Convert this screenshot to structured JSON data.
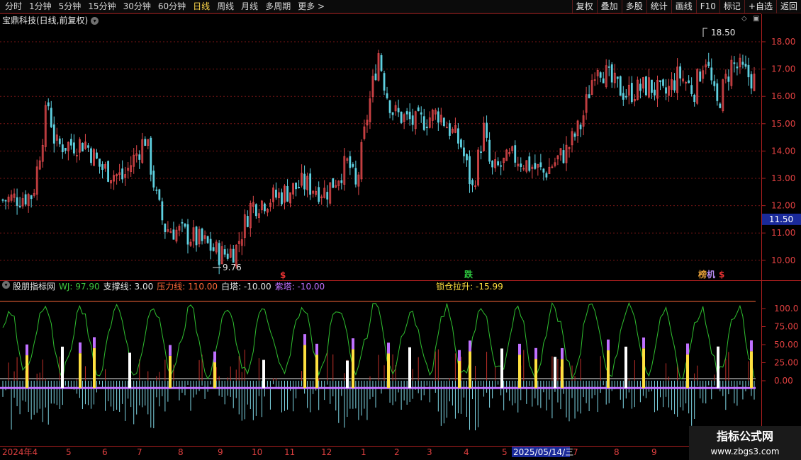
{
  "toolbar": {
    "periods": [
      {
        "label": "分时"
      },
      {
        "label": "1分钟"
      },
      {
        "label": "5分钟"
      },
      {
        "label": "15分钟"
      },
      {
        "label": "30分钟"
      },
      {
        "label": "60分钟"
      },
      {
        "label": "日线",
        "active": true
      },
      {
        "label": "周线"
      },
      {
        "label": "月线"
      },
      {
        "label": "多周期"
      },
      {
        "label": "更多 >"
      }
    ],
    "right_buttons": [
      {
        "label": "复权"
      },
      {
        "label": "叠加"
      },
      {
        "label": "多股"
      },
      {
        "label": "统计"
      },
      {
        "label": "画线"
      },
      {
        "label": "F10"
      },
      {
        "label": "标记"
      },
      {
        "label": "+自选"
      },
      {
        "label": "返回"
      }
    ]
  },
  "chart_title": "宝鼎科技(日线,前复权)",
  "price_axis": {
    "ticks": [
      "18.00",
      "17.00",
      "16.00",
      "15.00",
      "14.00",
      "13.00",
      "12.00",
      "11.00",
      "10.00"
    ],
    "current_price": "11.50",
    "current_color": "#1a2a9a"
  },
  "price_chart": {
    "high_label": "18.50",
    "low_label": "9.76",
    "markers": [
      {
        "text": "$",
        "color": "#e33"
      },
      {
        "text": "跌",
        "color": "#2ecc40"
      },
      {
        "text": "榜",
        "color": "#e8a23a"
      },
      {
        "text": "机",
        "color": "#b58bf0"
      },
      {
        "text": "$",
        "color": "#e33"
      }
    ],
    "colors": {
      "up": "#e0484b",
      "down": "#5ed0e0",
      "grid": "#7a1616"
    }
  },
  "indicator": {
    "name": "股朋指标网",
    "items": [
      {
        "label": "WJ: 97.90",
        "color": "#3fc83f"
      },
      {
        "label": "支撑线: 3.00",
        "color": "#e6e6e6"
      },
      {
        "label": "压力线: 110.00",
        "color": "#ff6a3a"
      },
      {
        "label": "白塔: -10.00",
        "color": "#e6e6e6"
      },
      {
        "label": "紫塔: -10.00",
        "color": "#c070ff"
      },
      {
        "label": "锁仓拉升: -15.99",
        "color": "#ffe040"
      }
    ],
    "axis_ticks": [
      "100.0",
      "75.00",
      "50.00",
      "25.00",
      "0.00"
    ]
  },
  "date_axis": {
    "labels": [
      "2024年4",
      "5",
      "6",
      "7",
      "8",
      "9",
      "10",
      "11",
      "12",
      "1",
      "2",
      "3",
      "4",
      "5",
      "2025/05/14/三",
      "7",
      "8",
      "9"
    ]
  },
  "watermark": {
    "title": "指标公式网",
    "url": "www.zbgs3.com"
  }
}
